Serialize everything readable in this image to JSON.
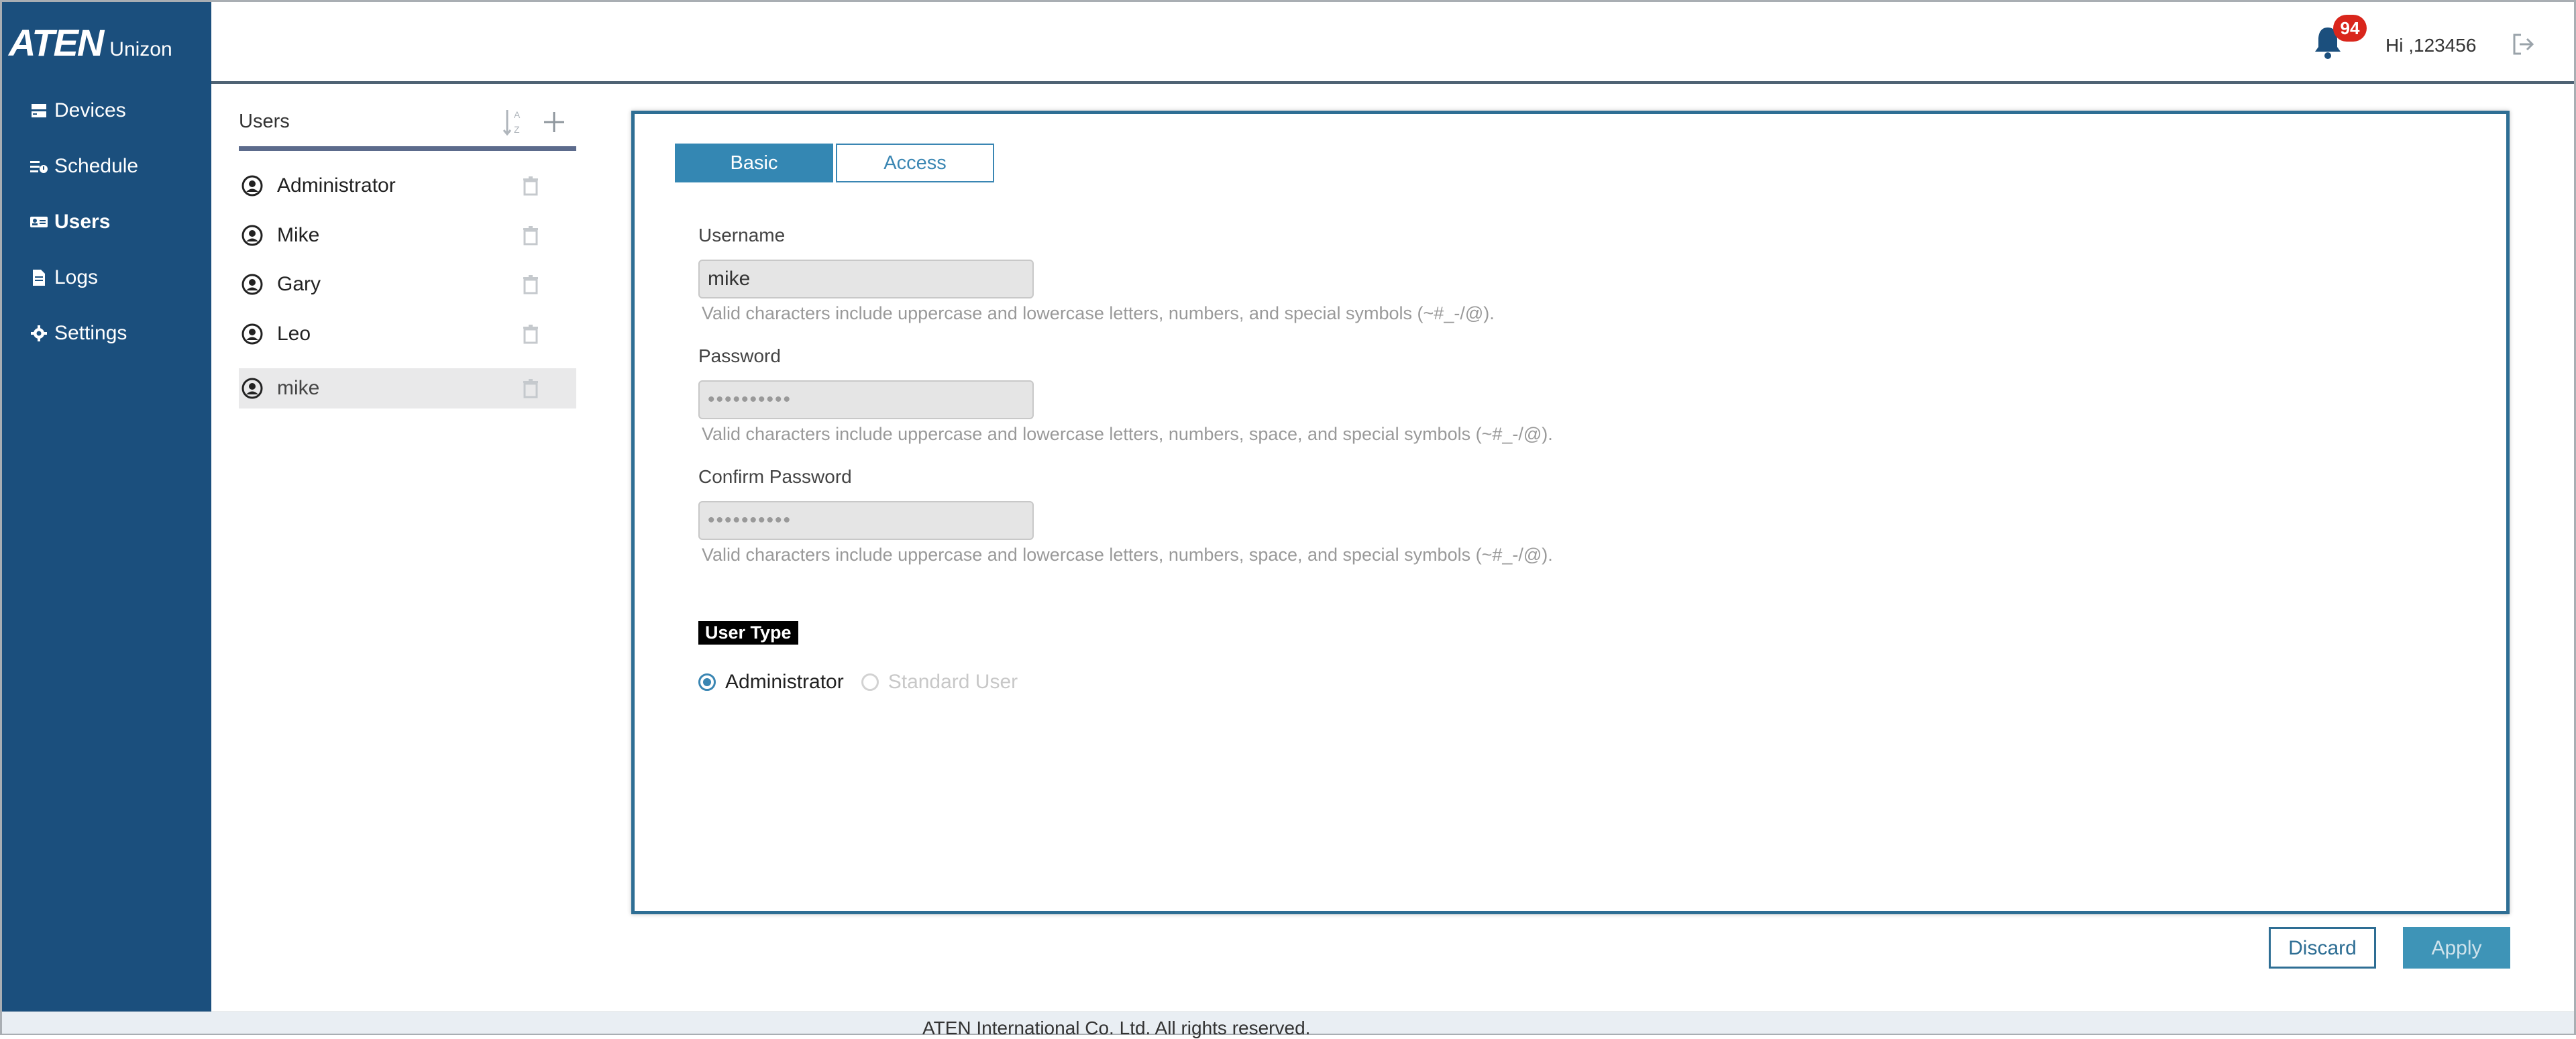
{
  "header": {
    "logo_brand": "ATEN",
    "logo_product": "Unizon",
    "notification_count": "94",
    "greeting": "Hi ,123456"
  },
  "sidebar": {
    "items": [
      {
        "label": "Devices",
        "icon": "devices-icon"
      },
      {
        "label": "Schedule",
        "icon": "schedule-icon"
      },
      {
        "label": "Users",
        "icon": "users-icon",
        "active": true
      },
      {
        "label": "Logs",
        "icon": "logs-icon"
      },
      {
        "label": "Settings",
        "icon": "gear-icon"
      }
    ]
  },
  "users_panel": {
    "title": "Users",
    "users": [
      {
        "name": "Administrator"
      },
      {
        "name": "Mike"
      },
      {
        "name": "Gary"
      },
      {
        "name": "Leo"
      },
      {
        "name": "mike",
        "selected": true
      }
    ]
  },
  "form": {
    "tabs": {
      "basic": "Basic",
      "access": "Access"
    },
    "username": {
      "label": "Username",
      "value": "mike",
      "help": "Valid characters include uppercase and lowercase letters, numbers, and special symbols (~#_-/@)."
    },
    "password": {
      "label": "Password",
      "value": "••••••••••",
      "help": "Valid characters include uppercase and lowercase letters, numbers, space, and special symbols (~#_-/@)."
    },
    "confirm_password": {
      "label": "Confirm Password",
      "value": "••••••••••",
      "help": "Valid characters include uppercase and lowercase letters, numbers, space, and special symbols (~#_-/@)."
    },
    "user_type": {
      "label": "User Type",
      "options": [
        "Administrator",
        "Standard User"
      ],
      "selected": "Administrator"
    }
  },
  "actions": {
    "discard": "Discard",
    "apply": "Apply"
  },
  "footer": {
    "text": "ATEN International Co. Ltd. All rights reserved."
  },
  "colors": {
    "sidebar_bg": "#1b4f7d",
    "accent": "#3487b3",
    "badge": "#d9261c"
  }
}
